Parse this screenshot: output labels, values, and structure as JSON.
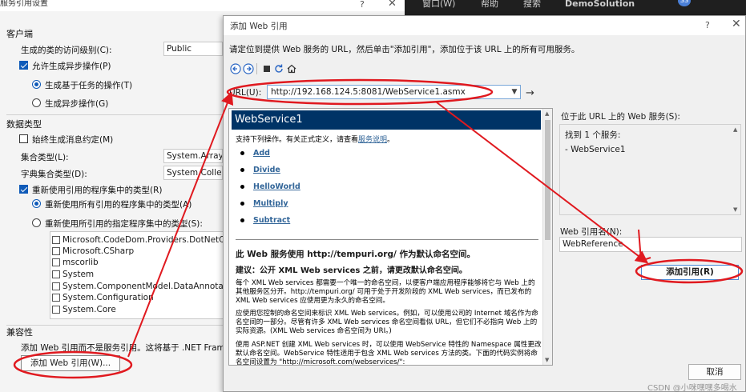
{
  "ide": {
    "frag1": "窗口(W)",
    "frag2": "帮助",
    "frag3": "搜索",
    "solution": "DemoSolution",
    "avatar": "SS"
  },
  "left_dialog": {
    "title": "服务引用设置",
    "help": "?",
    "close": "✕",
    "client_section": "客户端",
    "access_level_label": "生成的类的访问级别(C):",
    "access_level_value": "Public",
    "async_ops_label": "允许生成异步操作(P)",
    "async_ops_checked": true,
    "task_based_label": "生成基于任务的操作(T)",
    "async_based_label": "生成异步操作(G)",
    "datatype_section": "数据类型",
    "always_gen_contract_label": "始终生成消息约定(M)",
    "collection_type_label": "集合类型(L):",
    "collection_type_value": "System.Array",
    "dict_type_label": "字典集合类型(D):",
    "dict_type_value": "System.Collectio",
    "reuse_types_label": "重新使用引用的程序集中的类型(R)",
    "reuse_all_label": "重新使用所有引用的程序集中的类型(A)",
    "reuse_specified_label": "重新使用所引用的指定程序集中的类型(S):",
    "assemblies": [
      "Microsoft.CodeDom.Providers.DotNetCom",
      "Microsoft.CSharp",
      "mscorlib",
      "System",
      "System.ComponentModel.DataAnnotation",
      "System.Configuration",
      "System.Core"
    ],
    "compat_section": "兼容性",
    "compat_text": "添加 Web 引用而不是服务引用。这将基于 .NET Framework",
    "add_web_ref_button": "添加 Web 引用(W)..."
  },
  "web_dialog": {
    "title": "添加 Web 引用",
    "help": "?",
    "close": "✕",
    "instructions": "请定位到提供 Web 服务的 URL，然后单击\"添加引用\"，添加位于该 URL 上的所有可用服务。",
    "url_label": "URL(U):",
    "url_value": "http://192.168.124.5:8081/WebService1.asmx",
    "browser": {
      "service_name": "WebService1",
      "intro_prefix": "支持下列操作。有关正式定义，请查看",
      "intro_link": "服务说明",
      "intro_suffix": "。",
      "operations": [
        "Add",
        "Divide",
        "HelloWorld",
        "Multiply",
        "Subtract"
      ],
      "ns_heading": "此 Web 服务使用 http://tempuri.org/ 作为默认命名空间。",
      "ns_subheading": "建议：公开 XML Web services 之前，请更改默认命名空间。",
      "para1": "每个 XML Web services 都需要一个唯一的命名空间，以便客户端应用程序能够将它与 Web 上的其他服务区分开。http://tempuri.org/ 可用于处于开发阶段的 XML Web services，而已发布的 XML Web services 应使用更为永久的命名空间。",
      "para2": "应使用您控制的命名空间来标识 XML Web services。例如，可以使用公司的 Internet 域名作为命名空间的一部分。尽管有许多 XML Web services 命名空间看似 URL，但它们不必指向 Web 上的实际资源。(XML Web services 命名空间为 URI。)",
      "para3": "使用 ASP.NET 创建 XML Web services 时，可以使用 WebService 特性的 Namespace 属性更改默认命名空间。WebService 特性适用于包含 XML Web services 方法的类。下面的代码实例将命名空间设置为 \"http://microsoft.com/webservices/\":"
    },
    "found_label": "位于此 URL 上的 Web 服务(S):",
    "found_count": "找到 1 个服务:",
    "found_service": "- WebService1",
    "ref_name_label": "Web 引用名(N):",
    "ref_name_value": "WebReference",
    "add_ref_button": "添加引用(R)",
    "cancel_button": "取消"
  },
  "watermark": "CSDN @小咪嘿嘿多喝水",
  "colors": {
    "annotation": "#e0191f",
    "service_header": "#003366",
    "checkbox_accent": "#0f5ab8",
    "link": "#336699"
  }
}
